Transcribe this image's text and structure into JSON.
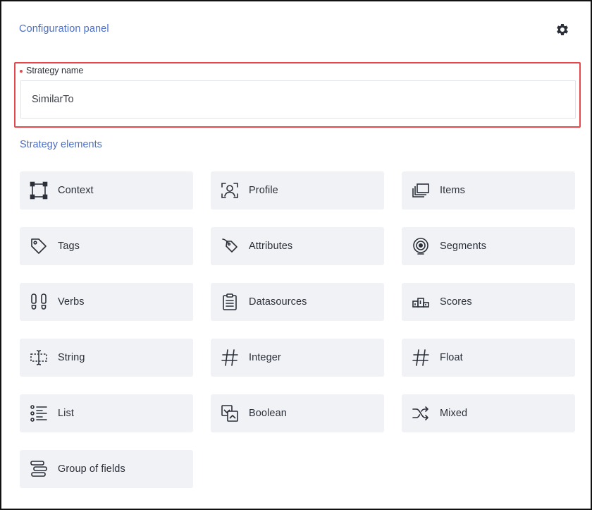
{
  "panel": {
    "title": "Configuration panel",
    "settings_icon": "gear-icon"
  },
  "strategy_name": {
    "label": "Strategy name",
    "required": true,
    "value": "SimilarTo",
    "highlight_color": "#e5474b"
  },
  "elements": {
    "title": "Strategy elements",
    "items": [
      {
        "label": "Context",
        "icon": "context-icon"
      },
      {
        "label": "Profile",
        "icon": "profile-icon"
      },
      {
        "label": "Items",
        "icon": "items-icon"
      },
      {
        "label": "Tags",
        "icon": "tag-icon"
      },
      {
        "label": "Attributes",
        "icon": "attributes-icon"
      },
      {
        "label": "Segments",
        "icon": "segments-icon"
      },
      {
        "label": "Verbs",
        "icon": "footprints-icon"
      },
      {
        "label": "Datasources",
        "icon": "clipboard-icon"
      },
      {
        "label": "Scores",
        "icon": "podium-icon"
      },
      {
        "label": "String",
        "icon": "text-cursor-icon"
      },
      {
        "label": "Integer",
        "icon": "hash-icon"
      },
      {
        "label": "Float",
        "icon": "hash-icon"
      },
      {
        "label": "List",
        "icon": "list-icon"
      },
      {
        "label": "Boolean",
        "icon": "boolean-icon"
      },
      {
        "label": "Mixed",
        "icon": "shuffle-icon"
      },
      {
        "label": "Group of fields",
        "icon": "group-fields-icon"
      }
    ]
  },
  "colors": {
    "accent": "#4d6fc7",
    "tile_background": "#f1f2f6",
    "text": "#2b2f38"
  }
}
